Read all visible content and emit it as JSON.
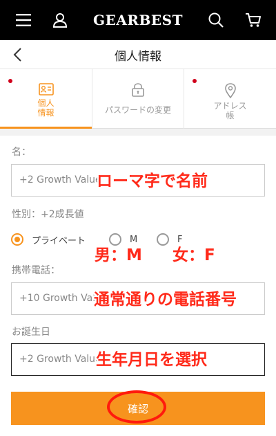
{
  "header": {
    "logo_text": "GEARBEST",
    "icons": [
      "menu-icon",
      "user-icon",
      "search-icon",
      "cart-icon"
    ]
  },
  "titlebar": {
    "title": "個人情報",
    "back_icon": "chevron-left-icon"
  },
  "tabs": [
    {
      "label": "個人\n情報",
      "icon": "id-card-icon",
      "active": true,
      "badge": true
    },
    {
      "label": "パスワードの変更",
      "icon": "lock-icon",
      "active": false,
      "badge": false
    },
    {
      "label": "アドレス\n帳",
      "icon": "location-pin-icon",
      "active": false,
      "badge": true
    }
  ],
  "form": {
    "name": {
      "label": "名：",
      "placeholder": "+2 Growth Value",
      "annotation": "ローマ字で名前"
    },
    "gender": {
      "label": "性別：+2成長値",
      "options": [
        "プライベート",
        "M",
        "F"
      ],
      "selected": "プライベート",
      "annotation_m": "男：M",
      "annotation_f": "女：F"
    },
    "phone": {
      "label": "携帯電話：",
      "placeholder": "+10 Growth Value",
      "annotation": "通常通りの電話番号"
    },
    "birthday": {
      "label": "お誕生日",
      "placeholder": "+2 Growth Value",
      "annotation": "生年月日を選択"
    },
    "confirm_label": "確認"
  },
  "colors": {
    "accent": "#f7931e",
    "annotation": "#ff2a1a",
    "header_bg": "#000000",
    "badge": "#d0021b"
  }
}
